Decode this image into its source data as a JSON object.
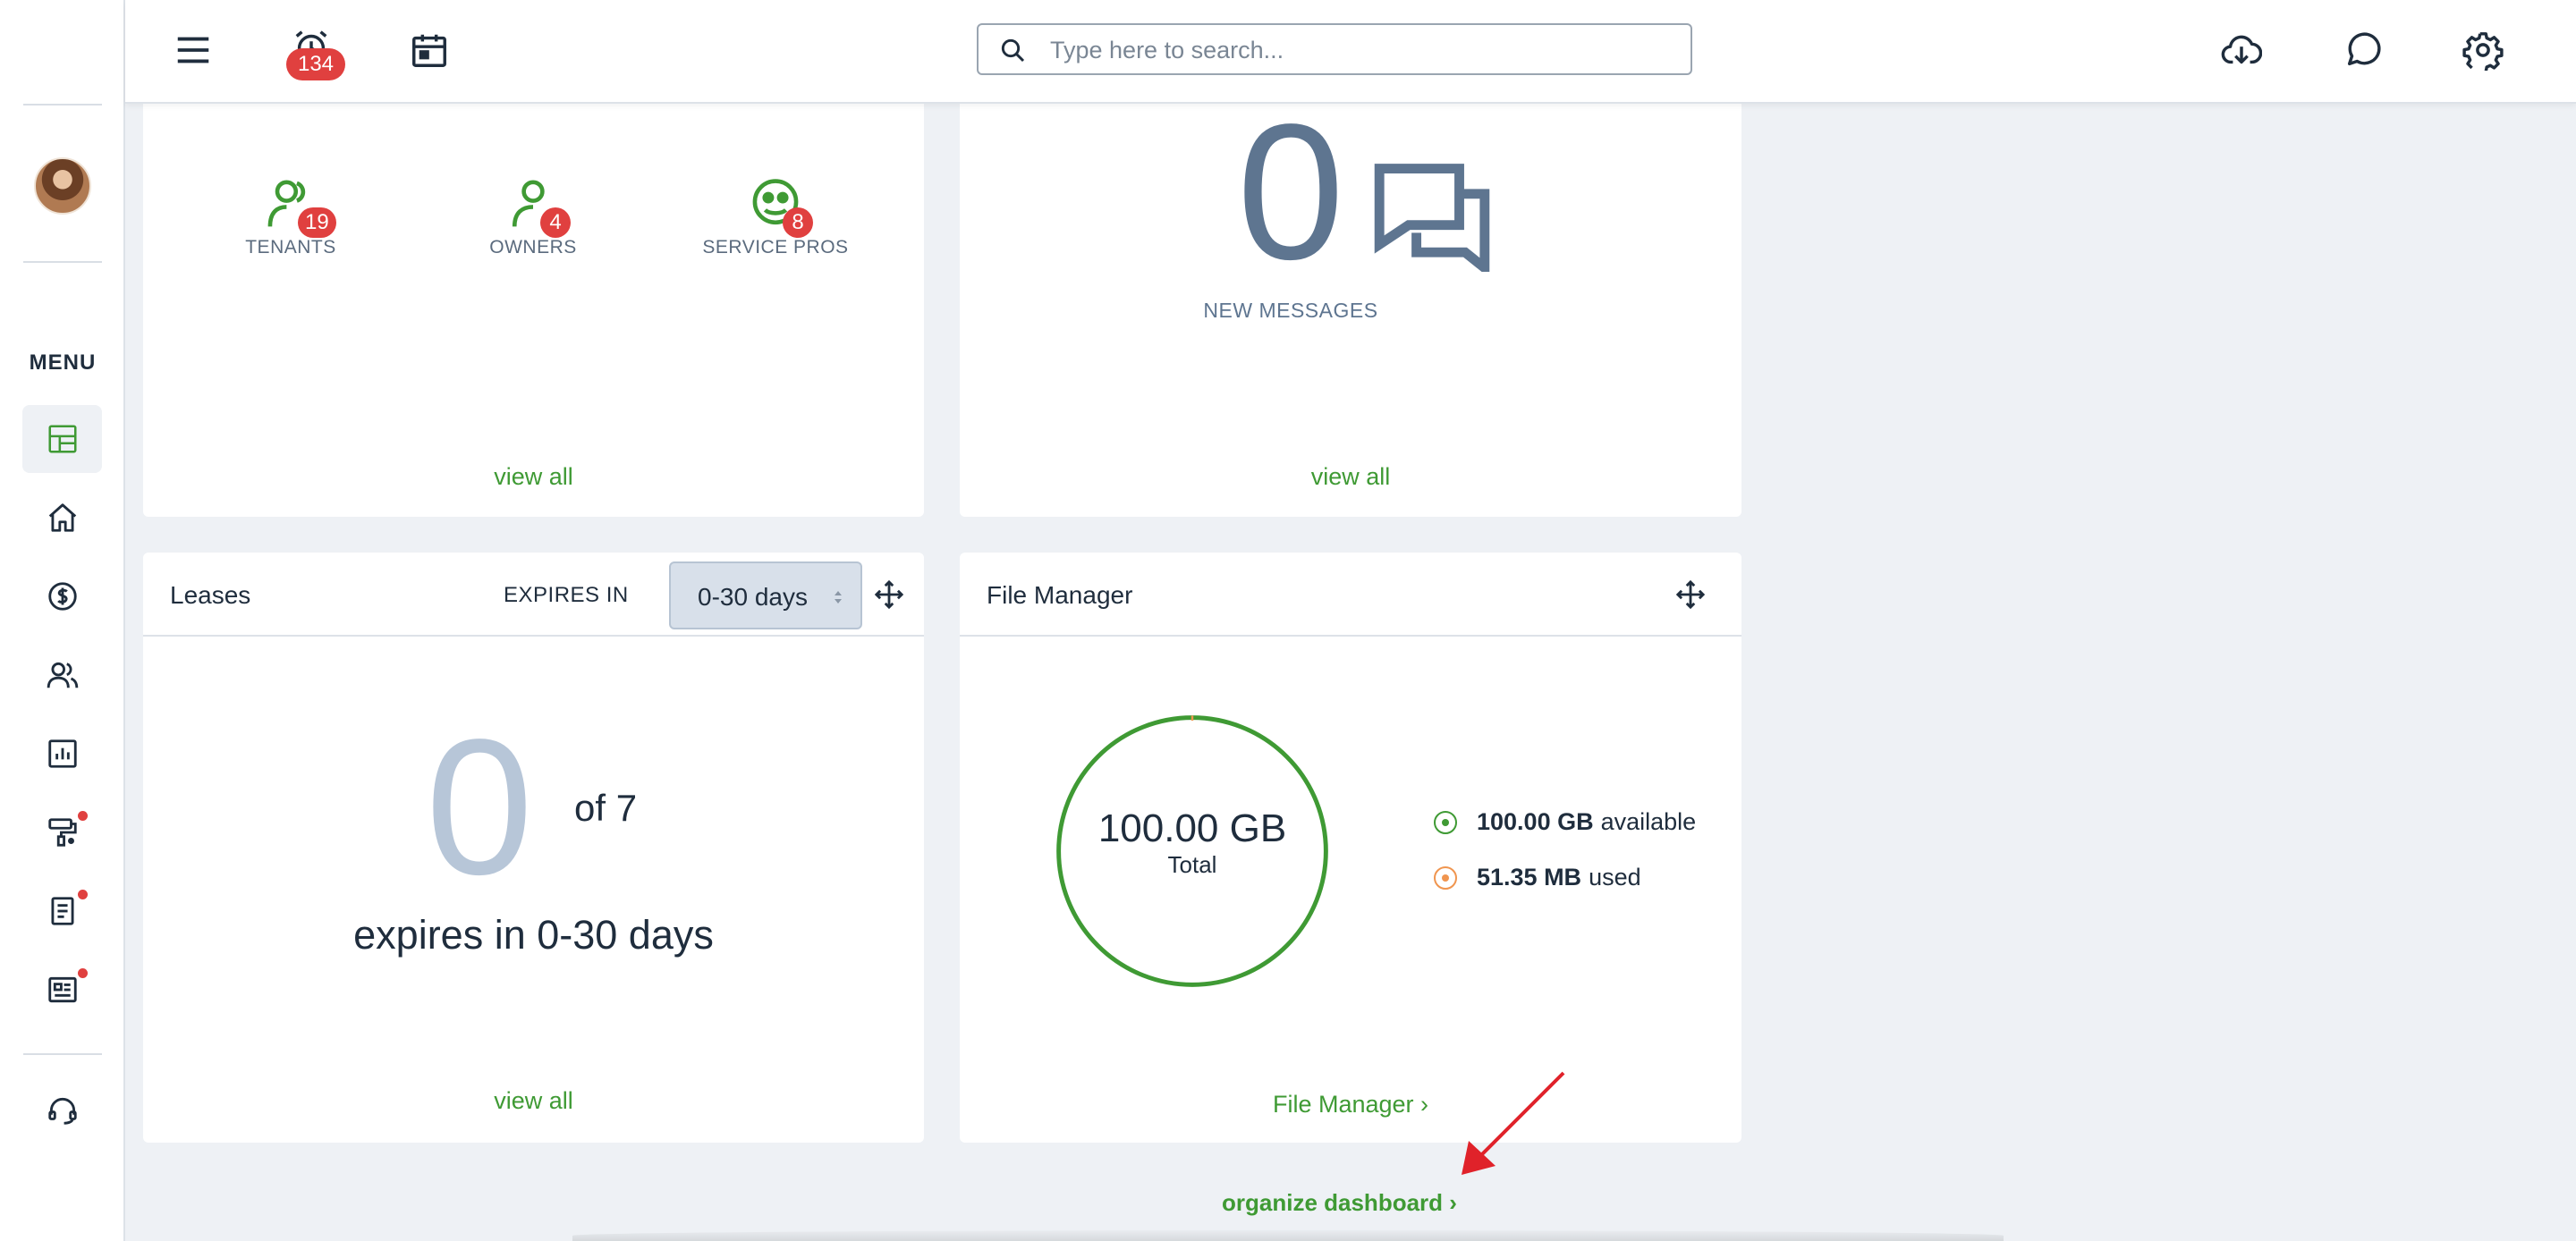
{
  "topbar": {
    "alarm_count": "134",
    "search_placeholder": "Type here to search..."
  },
  "sidebar": {
    "menu_label": "MENU",
    "items": [
      {
        "icon": "dashboard-icon",
        "active": true,
        "dot": false
      },
      {
        "icon": "home-icon",
        "active": false,
        "dot": false
      },
      {
        "icon": "dollar-icon",
        "active": false,
        "dot": false
      },
      {
        "icon": "people-icon",
        "active": false,
        "dot": false
      },
      {
        "icon": "reports-icon",
        "active": false,
        "dot": false
      },
      {
        "icon": "paint-roller-icon",
        "active": false,
        "dot": true
      },
      {
        "icon": "document-icon",
        "active": false,
        "dot": true
      },
      {
        "icon": "newspaper-icon",
        "active": false,
        "dot": true
      },
      {
        "icon": "headset-icon",
        "active": false,
        "dot": false
      }
    ]
  },
  "contacts_card": {
    "stats": [
      {
        "count": "19",
        "label": "TENANTS"
      },
      {
        "count": "4",
        "label": "OWNERS"
      },
      {
        "count": "8",
        "label": "SERVICE PROS"
      }
    ],
    "link": "view all"
  },
  "messages_card": {
    "count": "0",
    "label": "NEW MESSAGES",
    "link": "view all"
  },
  "leases_card": {
    "title": "Leases",
    "expires_label": "EXPIRES IN",
    "selected_range": "0-30 days",
    "count": "0",
    "of_total": "of 7",
    "caption": "expires in 0-30 days",
    "link": "view all"
  },
  "file_manager_card": {
    "title": "File Manager",
    "total_value": "100.00 GB",
    "total_label": "Total",
    "available_value": "100.00 GB",
    "available_label": "available",
    "used_value": "51.35 MB",
    "used_label": "used",
    "link": "File Manager ›"
  },
  "footer": {
    "organize_link": "organize dashboard ›"
  },
  "colors": {
    "accent_green": "#3f9a34",
    "badge_red": "#e0403f",
    "slate": "#5e7590",
    "used_orange": "#f0954f"
  }
}
